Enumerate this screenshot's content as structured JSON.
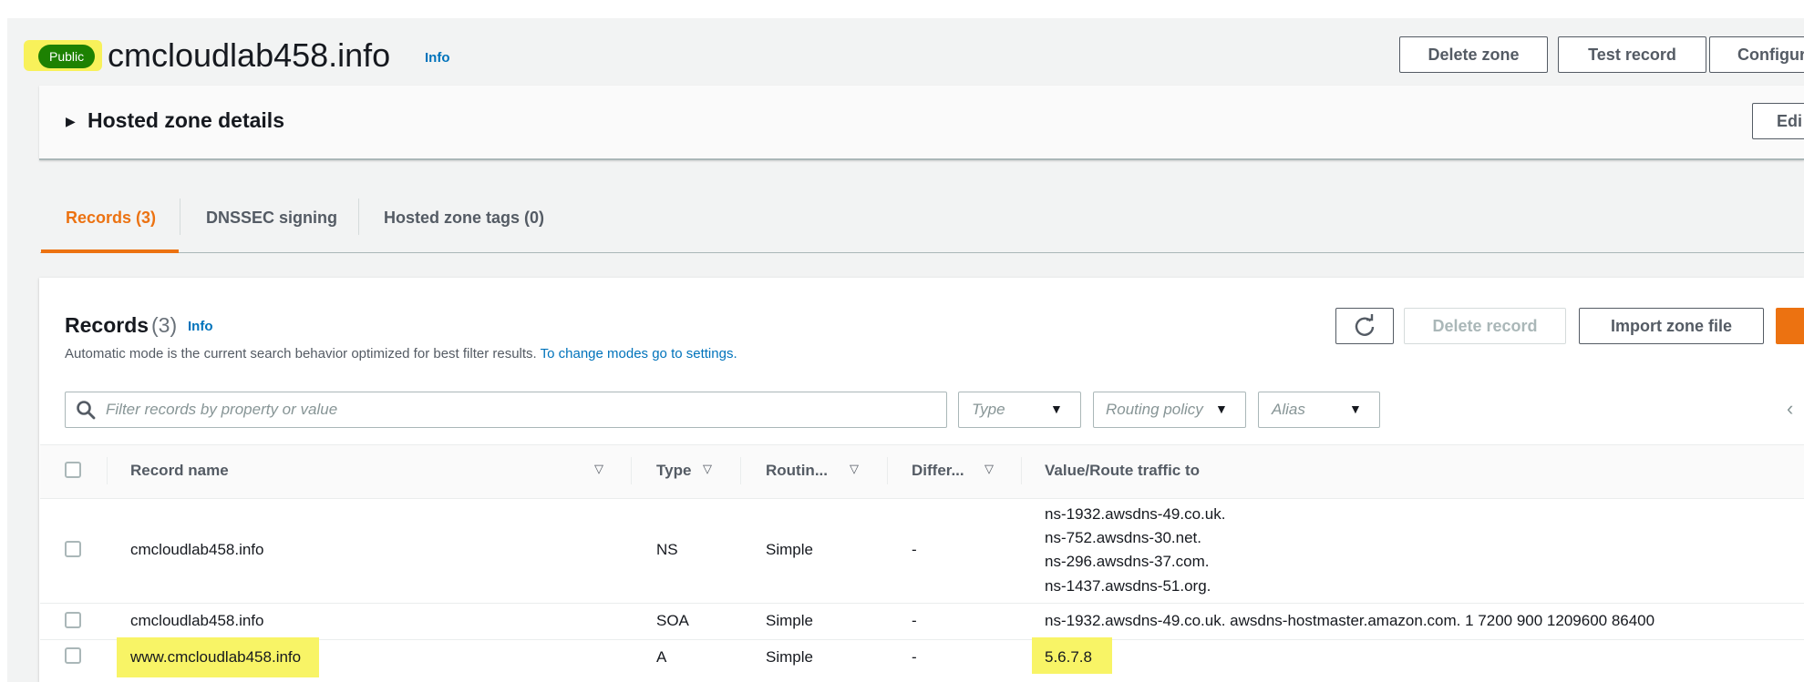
{
  "header": {
    "badge": "Public",
    "zone_name": "cmcloudlab458.info",
    "info": "Info",
    "buttons": {
      "delete_zone": "Delete zone",
      "test_record": "Test record",
      "configure": "Configur"
    }
  },
  "details": {
    "title": "Hosted zone details",
    "edit": "Edi"
  },
  "tabs": [
    {
      "label": "Records (3)",
      "active": true
    },
    {
      "label": "DNSSEC signing",
      "active": false
    },
    {
      "label": "Hosted zone tags (0)",
      "active": false
    }
  ],
  "records": {
    "title": "Records",
    "count": "(3)",
    "info": "Info",
    "description": "Automatic mode is the current search behavior optimized for best filter results.",
    "description_link": "To change modes go to settings.",
    "buttons": {
      "delete_record": "Delete record",
      "import_zone_file": "Import zone file"
    },
    "filters": {
      "search_placeholder": "Filter records by property or value",
      "type": "Type",
      "routing_policy": "Routing policy",
      "alias": "Alias"
    },
    "columns": [
      "Record name",
      "Type",
      "Routin...",
      "Differ...",
      "Value/Route traffic to"
    ],
    "rows": [
      {
        "name": "cmcloudlab458.info",
        "type": "NS",
        "routing": "Simple",
        "differ": "-",
        "values": [
          "ns-1932.awsdns-49.co.uk.",
          "ns-752.awsdns-30.net.",
          "ns-296.awsdns-37.com.",
          "ns-1437.awsdns-51.org."
        ]
      },
      {
        "name": "cmcloudlab458.info",
        "type": "SOA",
        "routing": "Simple",
        "differ": "-",
        "values": [
          "ns-1932.awsdns-49.co.uk. awsdns-hostmaster.amazon.com. 1 7200 900 1209600 86400"
        ]
      },
      {
        "name": "www.cmcloudlab458.info",
        "type": "A",
        "routing": "Simple",
        "differ": "-",
        "values": [
          "5.6.7.8"
        ]
      }
    ]
  },
  "colors": {
    "accent": "#ec7211",
    "link": "#0073bb",
    "badge": "#1d8102",
    "highlight": "#f8f15a"
  }
}
